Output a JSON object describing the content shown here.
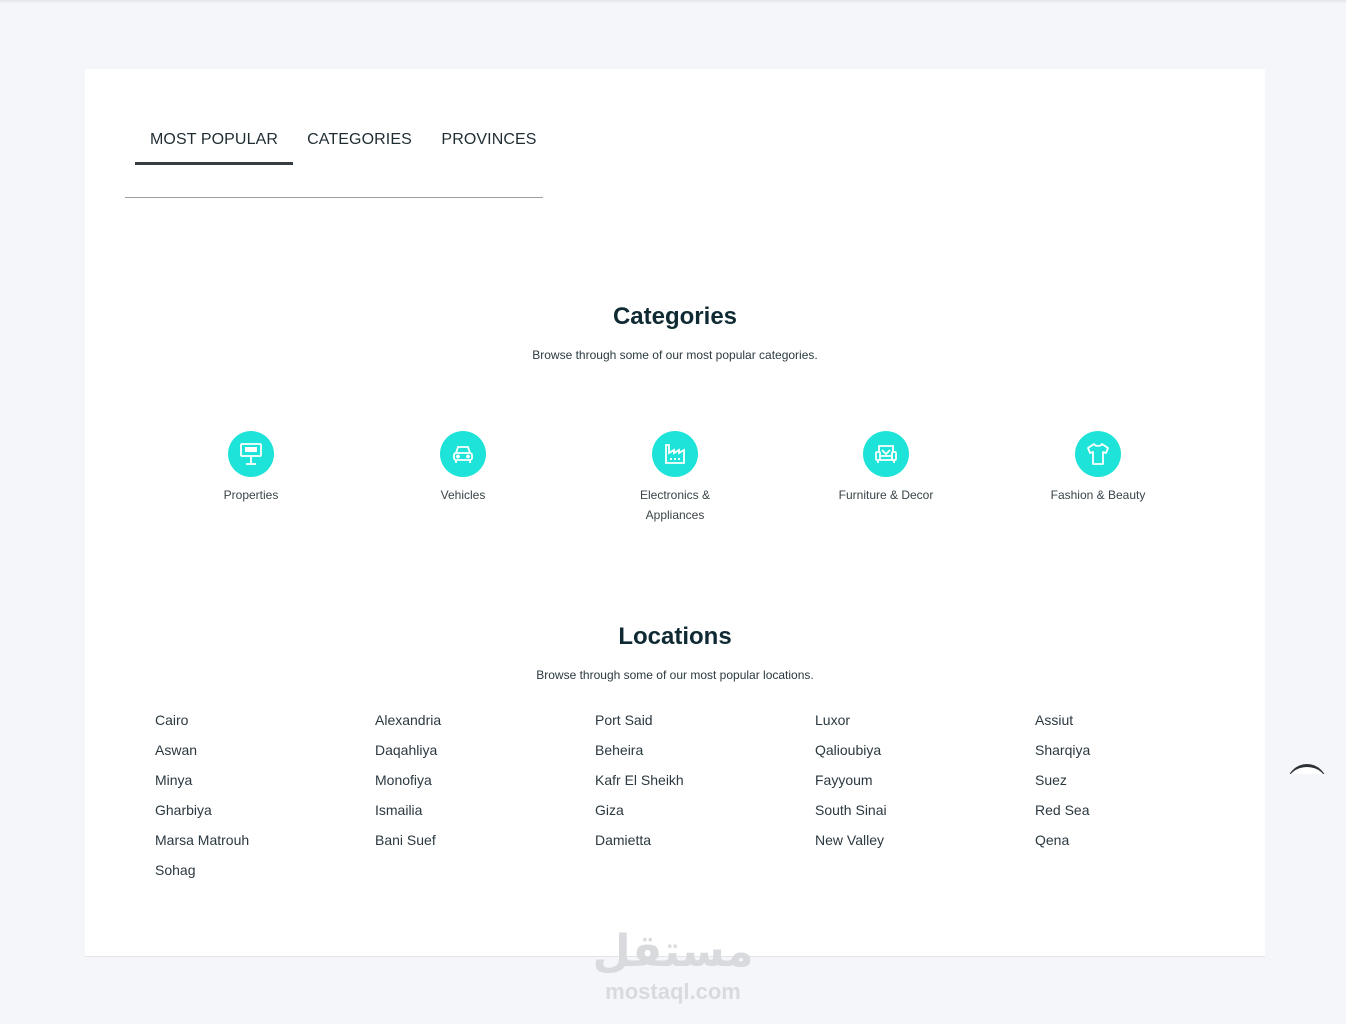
{
  "tabs": [
    {
      "label": "MOST POPULAR",
      "active": true
    },
    {
      "label": "CATEGORIES",
      "active": false
    },
    {
      "label": "PROVINCES",
      "active": false
    }
  ],
  "categories_section": {
    "title": "Categories",
    "subtitle": "Browse through some of our most popular categories.",
    "accent_color": "#1ee3d8",
    "items": [
      {
        "label": "Properties",
        "icon": "billboard-icon"
      },
      {
        "label": "Vehicles",
        "icon": "car-icon"
      },
      {
        "label": "Electronics & Appliances",
        "icon": "factory-icon"
      },
      {
        "label": "Furniture & Decor",
        "icon": "armchair-icon"
      },
      {
        "label": "Fashion & Beauty",
        "icon": "tshirt-icon"
      }
    ]
  },
  "locations_section": {
    "title": "Locations",
    "subtitle": "Browse through some of our most popular locations.",
    "columns": [
      [
        "Cairo",
        "Aswan",
        "Minya",
        "Gharbiya",
        "Marsa Matrouh",
        "Sohag"
      ],
      [
        "Alexandria",
        "Daqahliya",
        "Monofiya",
        "Ismailia",
        "Bani Suef"
      ],
      [
        "Port Said",
        "Beheira",
        "Kafr El Sheikh",
        "Giza",
        "Damietta"
      ],
      [
        "Luxor",
        "Qalioubiya",
        "Fayyoum",
        "South Sinai",
        "New Valley"
      ],
      [
        "Assiut",
        "Sharqiya",
        "Suez",
        "Red Sea",
        "Qena"
      ]
    ]
  },
  "watermark": {
    "arabic": "مستقل",
    "latin": "mostaql.com"
  }
}
